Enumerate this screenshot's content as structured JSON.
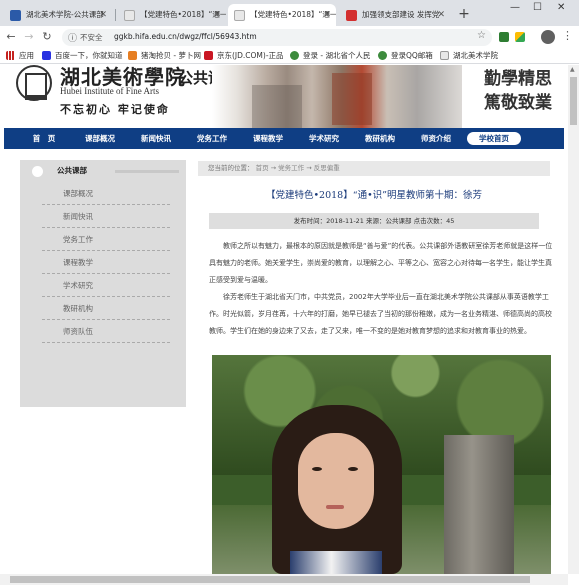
{
  "browser": {
    "tabs": [
      {
        "title": "湖北美术学院-公共课部",
        "active": false
      },
      {
        "title": "【党建特色•2018】“通一",
        "active": false
      },
      {
        "title": "【党建特色•2018】“通一",
        "active": true
      },
      {
        "title": "加强领支部建设 发挥党",
        "active": false
      }
    ],
    "new_tab": "+",
    "window_controls": [
      "—",
      "☐",
      "✕"
    ],
    "security_label": "不安全",
    "url": "ggkb.hifa.edu.cn/dwgz/ffcl/56943.htm"
  },
  "bookmarks": [
    {
      "label": "应用"
    },
    {
      "label": "百度一下，你就知道"
    },
    {
      "label": "猪淘抢贝 - 萝卜网"
    },
    {
      "label": "京东(JD.COM)-正品"
    },
    {
      "label": "登录 - 湖北省个人民"
    },
    {
      "label": "登录QQ邮箱"
    },
    {
      "label": "湖北美术学院"
    }
  ],
  "site": {
    "school_name_cn": "湖北美術學院",
    "department": "公共课部",
    "school_name_en": "Hubei Institute of Fine Arts",
    "slogan": "不忘初心 牢记使命",
    "calligraphy_line1": "勤學精思",
    "calligraphy_line2": "篤敬致業"
  },
  "nav": [
    {
      "label": "首　页"
    },
    {
      "label": "课部概况"
    },
    {
      "label": "新闻快讯"
    },
    {
      "label": "党务工作"
    },
    {
      "label": "课程教学"
    },
    {
      "label": "学术研究"
    },
    {
      "label": "教研机构"
    },
    {
      "label": "师资介绍"
    },
    {
      "label": "学校首页"
    }
  ],
  "sidebar": {
    "title": "公共课部",
    "items": [
      {
        "label": "课部概况"
      },
      {
        "label": "新闻快讯"
      },
      {
        "label": "党务工作"
      },
      {
        "label": "课程教学"
      },
      {
        "label": "学术研究"
      },
      {
        "label": "教研机构"
      },
      {
        "label": "师资队伍"
      }
    ]
  },
  "breadcrumb": {
    "prefix": "您当前的位置：",
    "items": [
      "首页",
      "党务工作",
      "反思偏重"
    ],
    "sep": " → "
  },
  "article": {
    "title": "【党建特色•2018】“通•识”明星教师第十期：徐芳",
    "meta": "发布时间：2018-11-21   来源：公共课部   点击次数：45",
    "paragraphs": [
      "教师之所以有魅力，最根本的原因就是教师是“善与爱”的代表。公共课部外语教研室徐芳老师就是这样一位具有魅力的老师。她关爱学生，崇尚爱的教育，以理解之心、平等之心、宽容之心对待每一名学生，能让学生真正感受到爱与温暖。",
      "徐芳老师生于湖北省天门市，中共党员，2002年大学毕业后一直在湖北美术学院公共课部从事英语教学工作。时光似箭，岁月荏苒，十六年的打磨，她早已褪去了当初的那份稚嫩，成为一名业务精湛、师德高尚的高校教师。学生们在她的身边来了又去，走了又来，唯一不变的是她对教育梦想的追求和对教育事业的热爱。"
    ]
  },
  "colors": {
    "nav_blue": "#0f3e84",
    "title_blue": "#1a3a7a",
    "sidebar_gray": "#dcdcdc"
  }
}
